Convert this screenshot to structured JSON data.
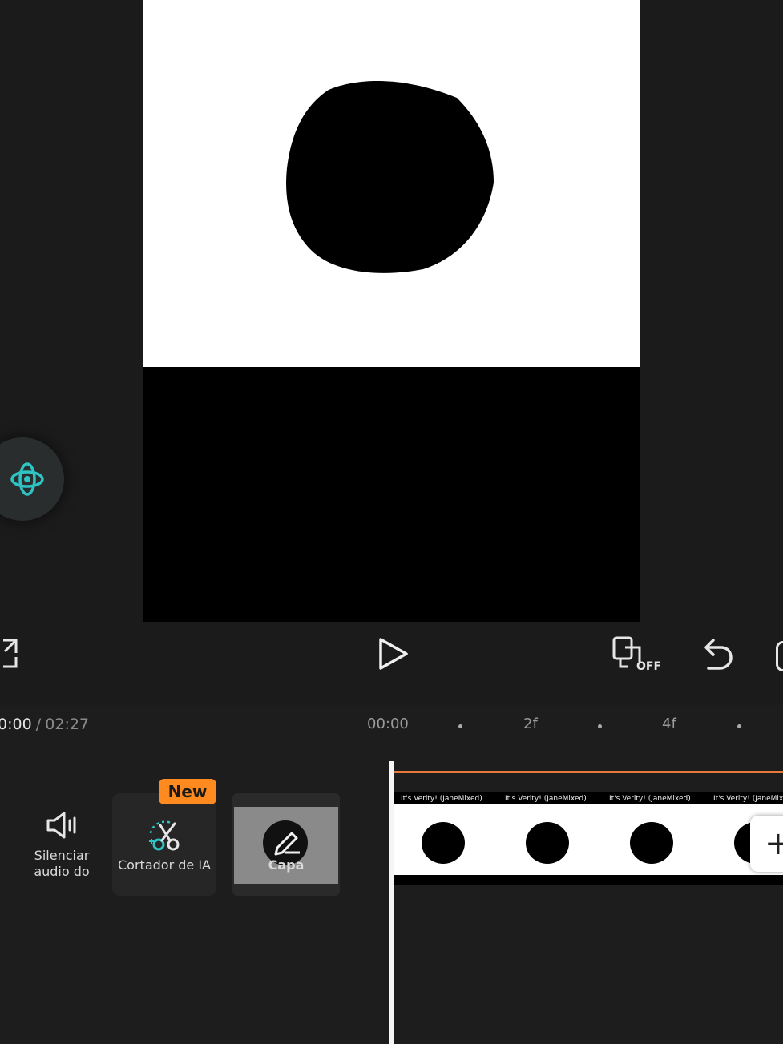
{
  "player": {
    "current_time": "0:00",
    "separator": "/",
    "total_time": "02:27"
  },
  "ruler": {
    "start": "00:00",
    "marks": [
      "2f",
      "4f"
    ]
  },
  "tools": {
    "mute": {
      "label_line1": "Silenciar",
      "label_line2": "audio do"
    },
    "ai_cutter": {
      "label": "Cortador de IA",
      "badge": "New"
    },
    "cover": {
      "label": "Capa"
    }
  },
  "clips": {
    "caption": "It's Verity! (JaneMixed)"
  },
  "controls": {
    "keyframe_state": "OFF"
  },
  "colors": {
    "accent_teal": "#2ec4c4",
    "badge_orange": "#ff8a1f",
    "track_orange": "#e8773b"
  },
  "icons": [
    "fullscreen-icon",
    "play-icon",
    "keyframe-off-icon",
    "undo-icon",
    "ai-assistant-icon",
    "speaker-icon",
    "ai-scissors-icon",
    "edit-pencil-icon",
    "plus-icon"
  ]
}
